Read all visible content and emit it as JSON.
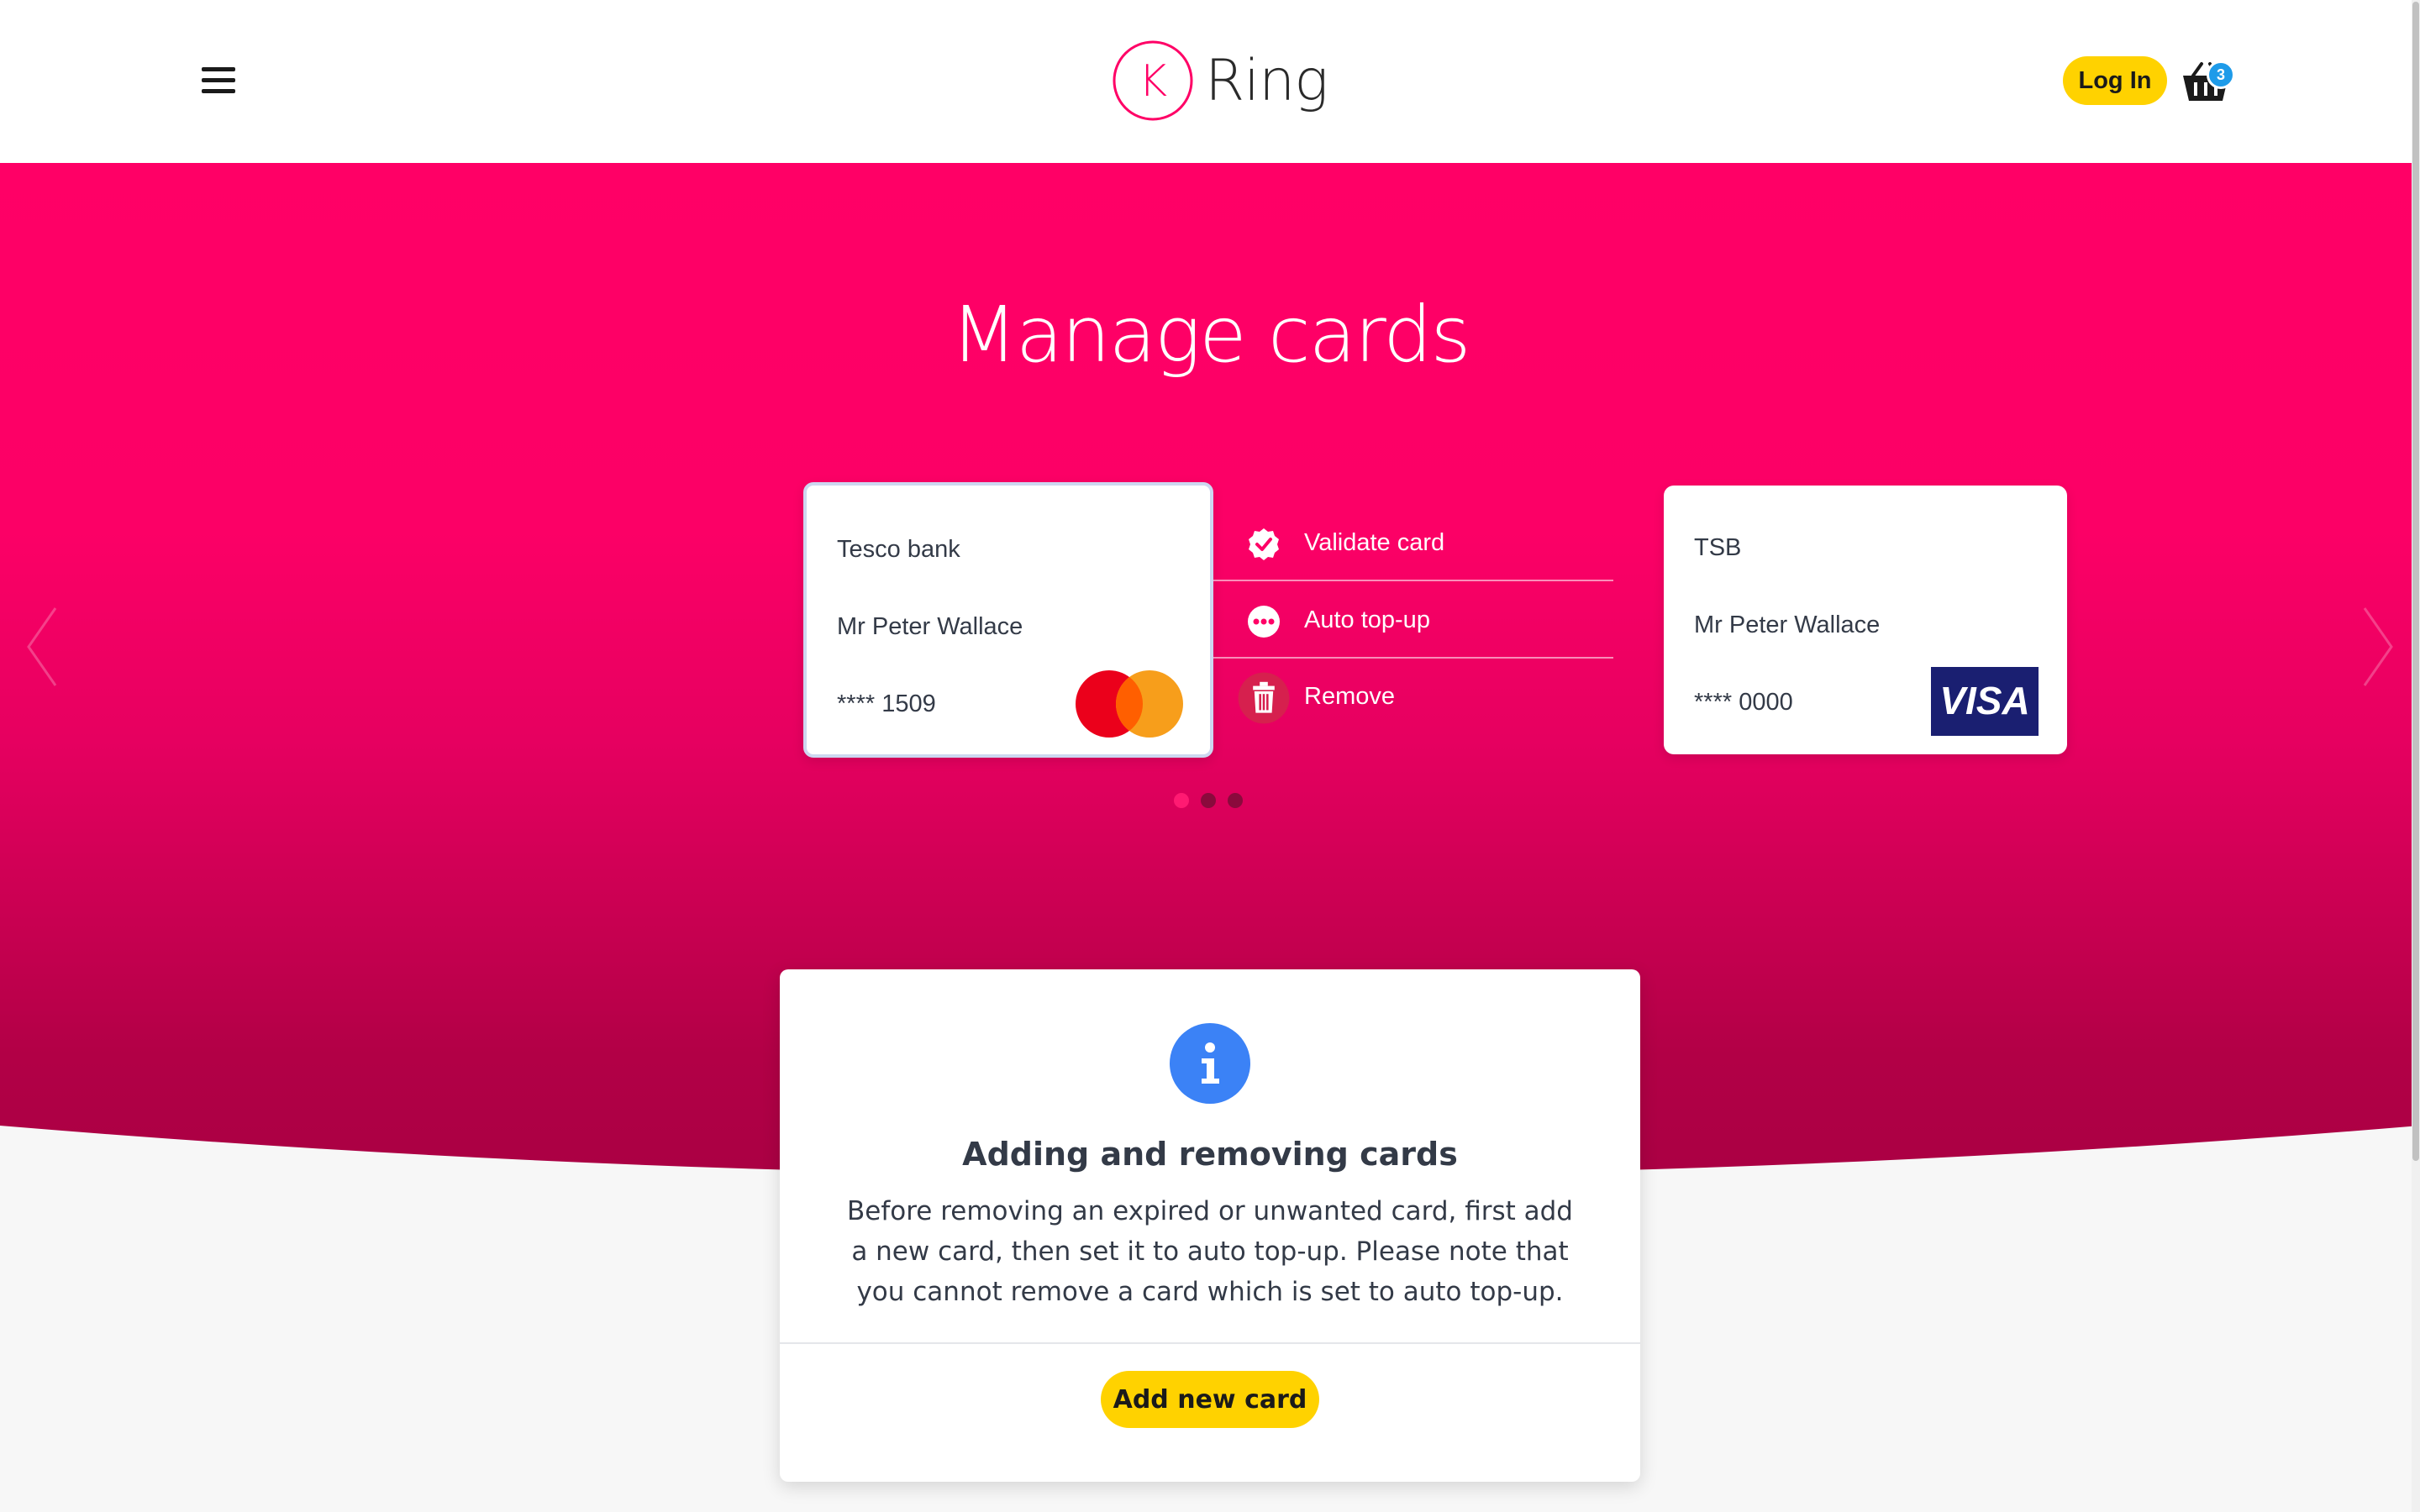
{
  "brand": {
    "logo_letter": "K",
    "name": "Ring",
    "accent": "#ff0066"
  },
  "header": {
    "menu_icon": "hamburger-menu-icon",
    "login_label": "Log In",
    "basket_icon": "basket-icon",
    "basket_count": "3"
  },
  "hero": {
    "title": "Manage cards"
  },
  "cards": [
    {
      "bank": "Tesco bank",
      "holder": "Mr Peter Wallace",
      "number": "**** 1509",
      "network": "mastercard",
      "selected": true
    },
    {
      "bank": "TSB",
      "holder": "Mr Peter Wallace",
      "number": "**** 0000",
      "network": "VISA",
      "selected": false
    }
  ],
  "card_actions": [
    {
      "label": "Validate card",
      "icon": "verified-check-icon"
    },
    {
      "label": "Auto top-up",
      "icon": "more-dots-icon"
    },
    {
      "label": "Remove",
      "icon": "trash-icon"
    }
  ],
  "carousel": {
    "page_count": 3,
    "active_page": 1
  },
  "info": {
    "icon": "info-icon",
    "title": "Adding and removing cards",
    "text": "Before removing an expired or unwanted card, first add a new card, then set it to auto top-up. Please note that you cannot remove a card which is set to auto top-up.",
    "button_label": "Add new card"
  },
  "colors": {
    "primary_button": "#ffd200",
    "info_blue": "#3b82f6",
    "badge_blue": "#1e9be9",
    "visa_navy": "#1a1f71"
  }
}
